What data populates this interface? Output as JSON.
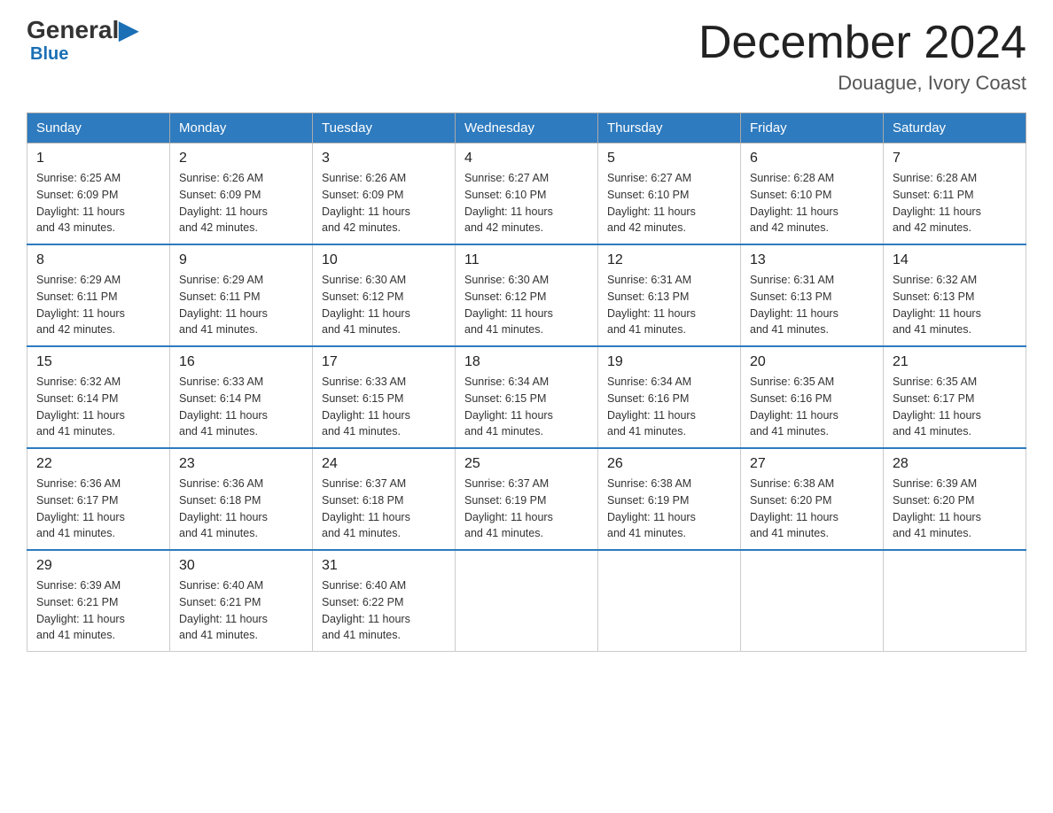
{
  "logo": {
    "name_part1": "General",
    "name_part2": "Blue"
  },
  "title": "December 2024",
  "subtitle": "Douague, Ivory Coast",
  "days_of_week": [
    "Sunday",
    "Monday",
    "Tuesday",
    "Wednesday",
    "Thursday",
    "Friday",
    "Saturday"
  ],
  "weeks": [
    [
      {
        "day": "1",
        "sunrise": "6:25 AM",
        "sunset": "6:09 PM",
        "daylight": "11 hours and 43 minutes."
      },
      {
        "day": "2",
        "sunrise": "6:26 AM",
        "sunset": "6:09 PM",
        "daylight": "11 hours and 42 minutes."
      },
      {
        "day": "3",
        "sunrise": "6:26 AM",
        "sunset": "6:09 PM",
        "daylight": "11 hours and 42 minutes."
      },
      {
        "day": "4",
        "sunrise": "6:27 AM",
        "sunset": "6:10 PM",
        "daylight": "11 hours and 42 minutes."
      },
      {
        "day": "5",
        "sunrise": "6:27 AM",
        "sunset": "6:10 PM",
        "daylight": "11 hours and 42 minutes."
      },
      {
        "day": "6",
        "sunrise": "6:28 AM",
        "sunset": "6:10 PM",
        "daylight": "11 hours and 42 minutes."
      },
      {
        "day": "7",
        "sunrise": "6:28 AM",
        "sunset": "6:11 PM",
        "daylight": "11 hours and 42 minutes."
      }
    ],
    [
      {
        "day": "8",
        "sunrise": "6:29 AM",
        "sunset": "6:11 PM",
        "daylight": "11 hours and 42 minutes."
      },
      {
        "day": "9",
        "sunrise": "6:29 AM",
        "sunset": "6:11 PM",
        "daylight": "11 hours and 41 minutes."
      },
      {
        "day": "10",
        "sunrise": "6:30 AM",
        "sunset": "6:12 PM",
        "daylight": "11 hours and 41 minutes."
      },
      {
        "day": "11",
        "sunrise": "6:30 AM",
        "sunset": "6:12 PM",
        "daylight": "11 hours and 41 minutes."
      },
      {
        "day": "12",
        "sunrise": "6:31 AM",
        "sunset": "6:13 PM",
        "daylight": "11 hours and 41 minutes."
      },
      {
        "day": "13",
        "sunrise": "6:31 AM",
        "sunset": "6:13 PM",
        "daylight": "11 hours and 41 minutes."
      },
      {
        "day": "14",
        "sunrise": "6:32 AM",
        "sunset": "6:13 PM",
        "daylight": "11 hours and 41 minutes."
      }
    ],
    [
      {
        "day": "15",
        "sunrise": "6:32 AM",
        "sunset": "6:14 PM",
        "daylight": "11 hours and 41 minutes."
      },
      {
        "day": "16",
        "sunrise": "6:33 AM",
        "sunset": "6:14 PM",
        "daylight": "11 hours and 41 minutes."
      },
      {
        "day": "17",
        "sunrise": "6:33 AM",
        "sunset": "6:15 PM",
        "daylight": "11 hours and 41 minutes."
      },
      {
        "day": "18",
        "sunrise": "6:34 AM",
        "sunset": "6:15 PM",
        "daylight": "11 hours and 41 minutes."
      },
      {
        "day": "19",
        "sunrise": "6:34 AM",
        "sunset": "6:16 PM",
        "daylight": "11 hours and 41 minutes."
      },
      {
        "day": "20",
        "sunrise": "6:35 AM",
        "sunset": "6:16 PM",
        "daylight": "11 hours and 41 minutes."
      },
      {
        "day": "21",
        "sunrise": "6:35 AM",
        "sunset": "6:17 PM",
        "daylight": "11 hours and 41 minutes."
      }
    ],
    [
      {
        "day": "22",
        "sunrise": "6:36 AM",
        "sunset": "6:17 PM",
        "daylight": "11 hours and 41 minutes."
      },
      {
        "day": "23",
        "sunrise": "6:36 AM",
        "sunset": "6:18 PM",
        "daylight": "11 hours and 41 minutes."
      },
      {
        "day": "24",
        "sunrise": "6:37 AM",
        "sunset": "6:18 PM",
        "daylight": "11 hours and 41 minutes."
      },
      {
        "day": "25",
        "sunrise": "6:37 AM",
        "sunset": "6:19 PM",
        "daylight": "11 hours and 41 minutes."
      },
      {
        "day": "26",
        "sunrise": "6:38 AM",
        "sunset": "6:19 PM",
        "daylight": "11 hours and 41 minutes."
      },
      {
        "day": "27",
        "sunrise": "6:38 AM",
        "sunset": "6:20 PM",
        "daylight": "11 hours and 41 minutes."
      },
      {
        "day": "28",
        "sunrise": "6:39 AM",
        "sunset": "6:20 PM",
        "daylight": "11 hours and 41 minutes."
      }
    ],
    [
      {
        "day": "29",
        "sunrise": "6:39 AM",
        "sunset": "6:21 PM",
        "daylight": "11 hours and 41 minutes."
      },
      {
        "day": "30",
        "sunrise": "6:40 AM",
        "sunset": "6:21 PM",
        "daylight": "11 hours and 41 minutes."
      },
      {
        "day": "31",
        "sunrise": "6:40 AM",
        "sunset": "6:22 PM",
        "daylight": "11 hours and 41 minutes."
      },
      null,
      null,
      null,
      null
    ]
  ],
  "labels": {
    "sunrise": "Sunrise:",
    "sunset": "Sunset:",
    "daylight": "Daylight:"
  }
}
